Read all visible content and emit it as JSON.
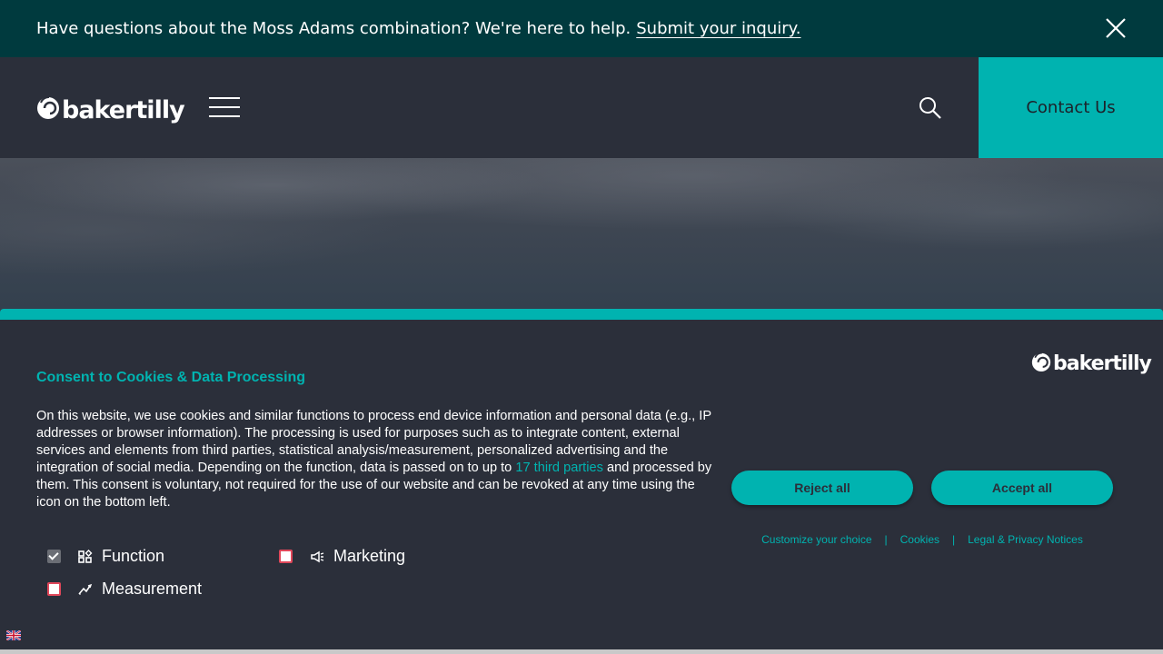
{
  "announcement": {
    "text": "Have questions about the Moss Adams combination? We're here to help.",
    "link": "Submit your inquiry."
  },
  "header": {
    "logo_text": "bakertilly",
    "contact_label": "Contact Us"
  },
  "consent": {
    "logo_text": "bakertilly",
    "title": "Consent to Cookies & Data Processing",
    "body_before": "On this website, we use cookies and similar functions to process end device information and personal data (e.g., IP addresses or browser information). The processing is used for purposes such as to integrate content, external services and elements from third parties, statistical analysis/measurement, personalized advertising and the integration of social media. Depending on the function, data is passed on to up to ",
    "third_parties_link": "17 third parties",
    "body_after": " and processed by them. This consent is voluntary, not required for the use of our website and can be revoked at any time using the icon on the bottom left.",
    "options": [
      {
        "label": "Function",
        "checked": true
      },
      {
        "label": "Marketing",
        "checked": false
      },
      {
        "label": "Measurement",
        "checked": false
      }
    ],
    "reject_label": "Reject all",
    "accept_label": "Accept all",
    "links": [
      "Customize your choice",
      "Cookies",
      "Legal & Privacy Notices"
    ],
    "separator": "|"
  },
  "colors": {
    "accent": "#00b3b0",
    "announce_bg": "#003a3e",
    "panel_bg": "#2b2f3a"
  },
  "icons": [
    "close-icon",
    "logo-mark-icon",
    "menu-icon",
    "search-icon",
    "function-icon",
    "marketing-icon",
    "measurement-icon",
    "language-flag-icon"
  ]
}
